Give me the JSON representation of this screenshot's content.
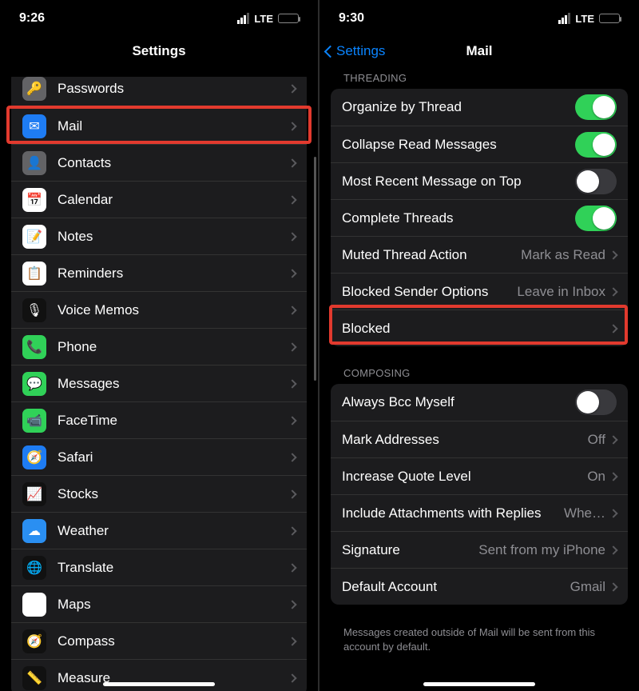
{
  "left": {
    "time": "9:26",
    "carrier": "LTE",
    "title": "Settings",
    "items": [
      {
        "label": "Passwords",
        "icon": "key-icon",
        "bg": "ic-grey",
        "glyph": "🔑"
      },
      {
        "label": "Mail",
        "icon": "mail-icon",
        "bg": "ic-blue",
        "glyph": "✉"
      },
      {
        "label": "Contacts",
        "icon": "contacts-icon",
        "bg": "ic-grey",
        "glyph": "👤"
      },
      {
        "label": "Calendar",
        "icon": "calendar-icon",
        "bg": "ic-calendar",
        "glyph": "📅"
      },
      {
        "label": "Notes",
        "icon": "notes-icon",
        "bg": "ic-yellow",
        "glyph": "📝"
      },
      {
        "label": "Reminders",
        "icon": "reminders-icon",
        "bg": "ic-reminders",
        "glyph": "📋"
      },
      {
        "label": "Voice Memos",
        "icon": "voice-memos-icon",
        "bg": "ic-voicememos",
        "glyph": "🎙"
      },
      {
        "label": "Phone",
        "icon": "phone-icon",
        "bg": "ic-phone",
        "glyph": "📞"
      },
      {
        "label": "Messages",
        "icon": "messages-icon",
        "bg": "ic-messages",
        "glyph": "💬"
      },
      {
        "label": "FaceTime",
        "icon": "facetime-icon",
        "bg": "ic-facetime",
        "glyph": "📹"
      },
      {
        "label": "Safari",
        "icon": "safari-icon",
        "bg": "ic-safari",
        "glyph": "🧭"
      },
      {
        "label": "Stocks",
        "icon": "stocks-icon",
        "bg": "ic-stocks",
        "glyph": "📈"
      },
      {
        "label": "Weather",
        "icon": "weather-icon",
        "bg": "ic-weather",
        "glyph": "☁"
      },
      {
        "label": "Translate",
        "icon": "translate-icon",
        "bg": "ic-translate",
        "glyph": "🌐"
      },
      {
        "label": "Maps",
        "icon": "maps-icon",
        "bg": "ic-maps",
        "glyph": "🗺"
      },
      {
        "label": "Compass",
        "icon": "compass-icon",
        "bg": "ic-compass",
        "glyph": "🧭"
      },
      {
        "label": "Measure",
        "icon": "measure-icon",
        "bg": "ic-measure",
        "glyph": "📏"
      }
    ]
  },
  "right": {
    "time": "9:30",
    "carrier": "LTE",
    "back": "Settings",
    "title": "Mail",
    "threading_header": "THREADING",
    "threading": [
      {
        "label": "Organize by Thread",
        "type": "switch",
        "on": true
      },
      {
        "label": "Collapse Read Messages",
        "type": "switch",
        "on": true
      },
      {
        "label": "Most Recent Message on Top",
        "type": "switch",
        "on": false
      },
      {
        "label": "Complete Threads",
        "type": "switch",
        "on": true
      },
      {
        "label": "Muted Thread Action",
        "type": "detail",
        "detail": "Mark as Read"
      },
      {
        "label": "Blocked Sender Options",
        "type": "detail",
        "detail": "Leave in Inbox"
      },
      {
        "label": "Blocked",
        "type": "detail",
        "detail": ""
      }
    ],
    "composing_header": "COMPOSING",
    "composing": [
      {
        "label": "Always Bcc Myself",
        "type": "switch",
        "on": false
      },
      {
        "label": "Mark Addresses",
        "type": "detail",
        "detail": "Off"
      },
      {
        "label": "Increase Quote Level",
        "type": "detail",
        "detail": "On"
      },
      {
        "label": "Include Attachments with Replies",
        "type": "detail",
        "detail": "Whe…"
      },
      {
        "label": "Signature",
        "type": "detail",
        "detail": "Sent from my iPhone"
      },
      {
        "label": "Default Account",
        "type": "detail",
        "detail": "Gmail"
      }
    ],
    "composing_footer": "Messages created outside of Mail will be sent from this account by default."
  }
}
